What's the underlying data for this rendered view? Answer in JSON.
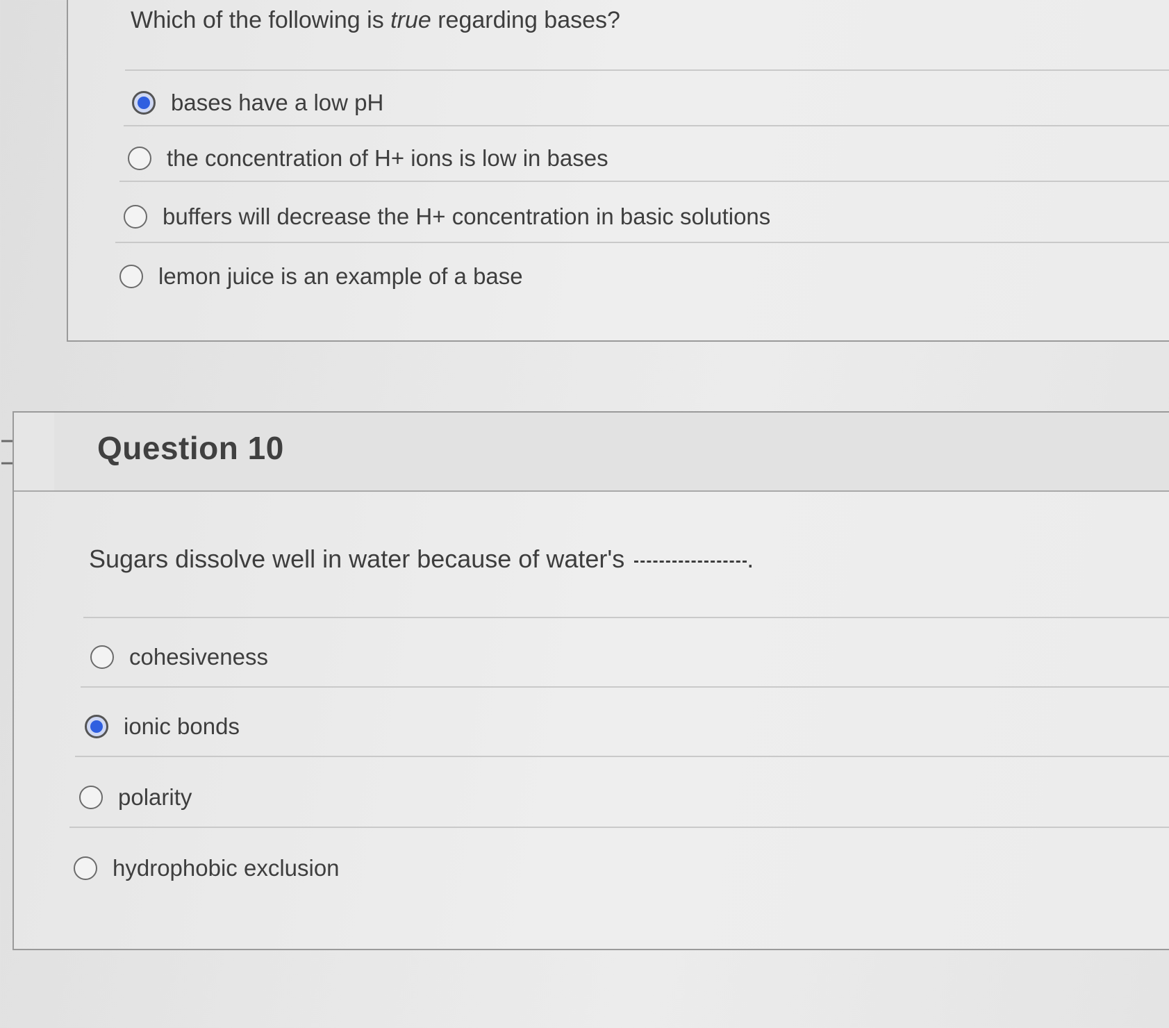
{
  "previous_question": {
    "text_before": "Which of the following is ",
    "text_emphasis": "true",
    "text_after": " regarding bases?",
    "options": [
      {
        "label": "bases have a low pH",
        "selected": true
      },
      {
        "label": "the concentration of H+ ions is low in bases",
        "selected": false
      },
      {
        "label": "buffers will decrease the H+ concentration in basic solutions",
        "selected": false
      },
      {
        "label": "lemon juice is an example of a base",
        "selected": false
      }
    ]
  },
  "question10": {
    "title": "Question 10",
    "text": "Sugars dissolve well in water because of water's",
    "text_end": ".",
    "options": [
      {
        "label": "cohesiveness",
        "selected": false
      },
      {
        "label": "ionic bonds",
        "selected": true
      },
      {
        "label": "polarity",
        "selected": false
      },
      {
        "label": "hydrophobic exclusion",
        "selected": false
      }
    ]
  },
  "colors": {
    "radio_selected": "#2f5fe0",
    "text": "#3d3d3d",
    "border": "#9a9a9a"
  },
  "icons": {
    "flag": "flag-outline-icon"
  }
}
